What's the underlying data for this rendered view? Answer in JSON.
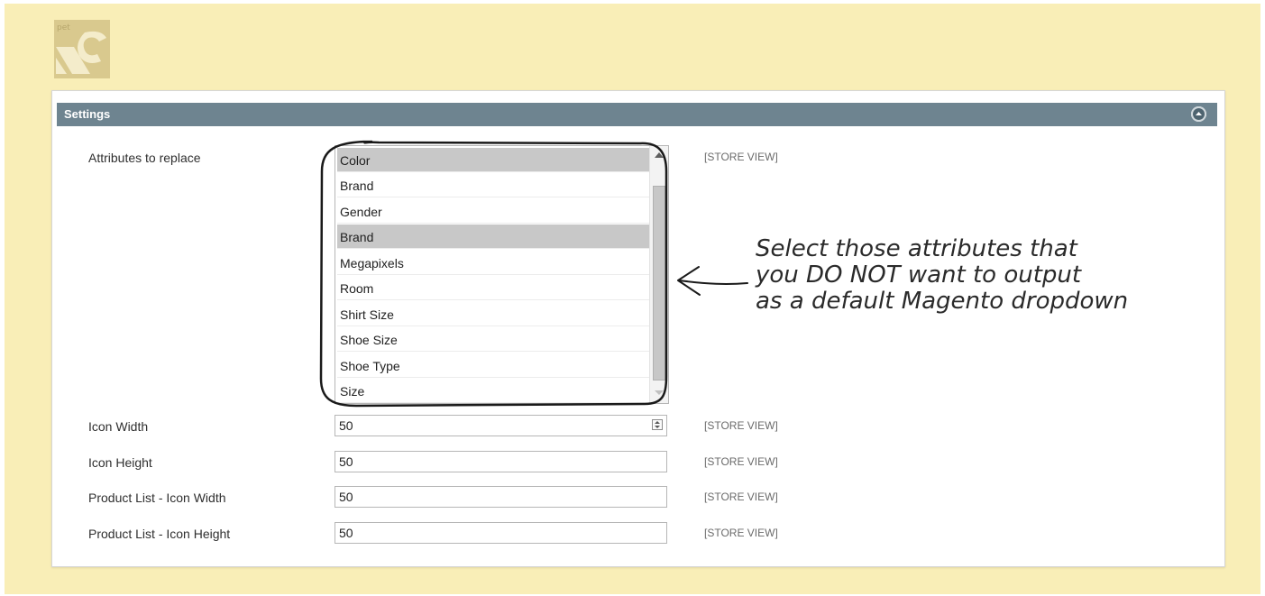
{
  "settings": {
    "title": "Settings",
    "attributes_label": "Attributes to replace",
    "attribute_options": [
      {
        "label": "Color",
        "selected": true
      },
      {
        "label": "Brand",
        "selected": false
      },
      {
        "label": "Gender",
        "selected": false
      },
      {
        "label": "Brand",
        "selected": true
      },
      {
        "label": "Megapixels",
        "selected": false
      },
      {
        "label": "Room",
        "selected": false
      },
      {
        "label": "Shirt Size",
        "selected": false
      },
      {
        "label": "Shoe Size",
        "selected": false
      },
      {
        "label": "Shoe Type",
        "selected": false
      },
      {
        "label": "Size",
        "selected": false
      }
    ],
    "scope_label": "[STORE VIEW]",
    "fields": [
      {
        "label": "Icon Width",
        "value": "50"
      },
      {
        "label": "Icon Height",
        "value": "50"
      },
      {
        "label": "Product List - Icon Width",
        "value": "50"
      },
      {
        "label": "Product List - Icon Height",
        "value": "50"
      }
    ]
  },
  "annotation": {
    "lines": [
      "Select those attributes that",
      "you DO NOT want to output",
      "as a default Magento dropdown"
    ]
  },
  "colors": {
    "page_background": "#f9eeb7",
    "header_background": "#6e8490",
    "selected_option": "#c8c8c8"
  }
}
